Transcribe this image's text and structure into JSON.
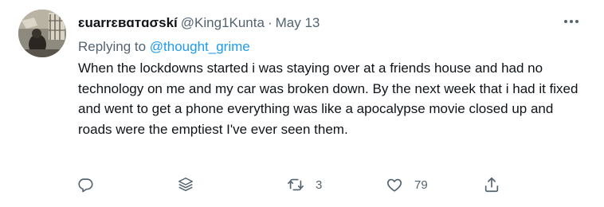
{
  "tweet": {
    "author": {
      "display_name": "ɛuarrɛвɑтɑσskí",
      "handle": "@King1Kunta",
      "separator": "·",
      "date": "May 13"
    },
    "reply_to": {
      "prefix": "Replying to ",
      "mention": "@thought_grime"
    },
    "text": "When the lockdowns started i was staying over at a friends house and had no technology on me and my car was broken down. By the next week that i had it fixed and went to get a phone everything was like a apocalypse movie closed up and roads were the emptiest I've ever seen them.",
    "actions": {
      "reply_icon": "speech-bubble-icon",
      "stack_icon": "layers-icon",
      "retweet_icon": "retweet-icon",
      "retweet_count": "3",
      "like_icon": "heart-icon",
      "like_count": "79",
      "share_icon": "share-icon"
    },
    "more_icon": "more-options-icon"
  },
  "colors": {
    "text_primary": "#0f1419",
    "text_secondary": "#536471",
    "accent": "#1d9bf0",
    "background": "#ffffff"
  }
}
